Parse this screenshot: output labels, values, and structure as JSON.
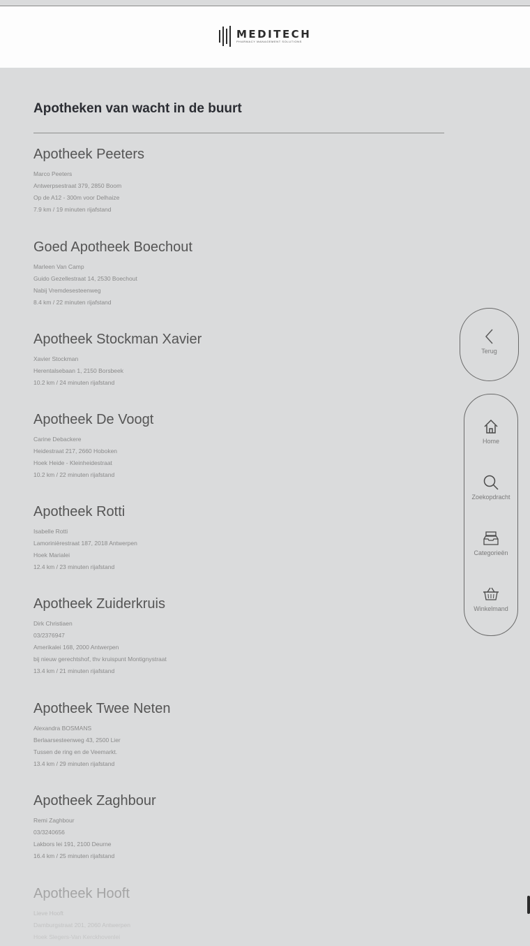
{
  "brand": {
    "name": "MEDITECH",
    "tagline": "PHARMACY MANAGEMENT SOLUTIONS"
  },
  "page": {
    "title": "Apotheken van wacht in de buurt"
  },
  "pharmacies": [
    {
      "name": "Apotheek Peeters",
      "lines": [
        "Marco Peeters",
        "Antwerpsestraat 379, 2850 Boom",
        "Op de A12 - 300m voor Delhaize",
        "7.9 km / 19 minuten rijafstand"
      ]
    },
    {
      "name": "Goed Apotheek Boechout",
      "lines": [
        "Marleen Van Camp",
        "Guido Gezellestraat 14, 2530 Boechout",
        "Nabij Vremdesesteenweg",
        "8.4 km / 22 minuten rijafstand"
      ]
    },
    {
      "name": "Apotheek Stockman Xavier",
      "lines": [
        "Xavier Stockman",
        "Herentalsebaan 1, 2150 Borsbeek",
        "10.2 km / 24 minuten rijafstand"
      ]
    },
    {
      "name": "Apotheek De Voogt",
      "lines": [
        "Carine Debackere",
        "Heidestraat 217, 2660 Hoboken",
        "Hoek Heide - Kleinheidestraat",
        "10.2 km / 22 minuten rijafstand"
      ]
    },
    {
      "name": "Apotheek Rotti",
      "lines": [
        "Isabelle Rotti",
        "Lamorinièrestraat 187, 2018 Antwerpen",
        "Hoek Marialei",
        "12.4 km / 23 minuten rijafstand"
      ]
    },
    {
      "name": "Apotheek Zuiderkruis",
      "lines": [
        "Dirk Christiaen",
        "03/2376947",
        "Amerikalei 168, 2000 Antwerpen",
        "bij nieuw gerechtshof, thv kruispunt Montignystraat",
        "13.4 km / 21 minuten rijafstand"
      ]
    },
    {
      "name": "Apotheek Twee Neten",
      "lines": [
        "Alexandra BOSMANS",
        "Berlaarsesteenweg 43, 2500 Lier",
        "Tussen de ring en de Veemarkt.",
        "13.4 km / 29 minuten rijafstand"
      ]
    },
    {
      "name": "Apotheek Zaghbour",
      "lines": [
        "Remi Zaghbour",
        "03/3240656",
        "Lakbors lei 191, 2100 Deurne",
        "16.4 km / 25 minuten rijafstand"
      ]
    },
    {
      "name": "Apotheek Hooft",
      "lines": [
        "Lieve Hooft",
        "Damburgstraat 201, 2060 Antwerpen",
        "Hoek Slegers-Van Kerckhovenlei"
      ]
    }
  ],
  "nav": {
    "back": {
      "label": "Terug",
      "icon": "chevron-left-icon"
    },
    "items": [
      {
        "label": "Home",
        "icon": "home-icon"
      },
      {
        "label": "Zoekopdracht",
        "icon": "search-icon"
      },
      {
        "label": "Categorieën",
        "icon": "tray-icon"
      },
      {
        "label": "Winkelmand",
        "icon": "basket-icon"
      }
    ]
  },
  "colors": {
    "background": "#dadbdc",
    "header": "#fdfdfd",
    "title": "#2b2d33",
    "pharmacy_name": "#555555",
    "detail_text": "#8a8a8a",
    "nav_border": "#6a6a6a"
  }
}
